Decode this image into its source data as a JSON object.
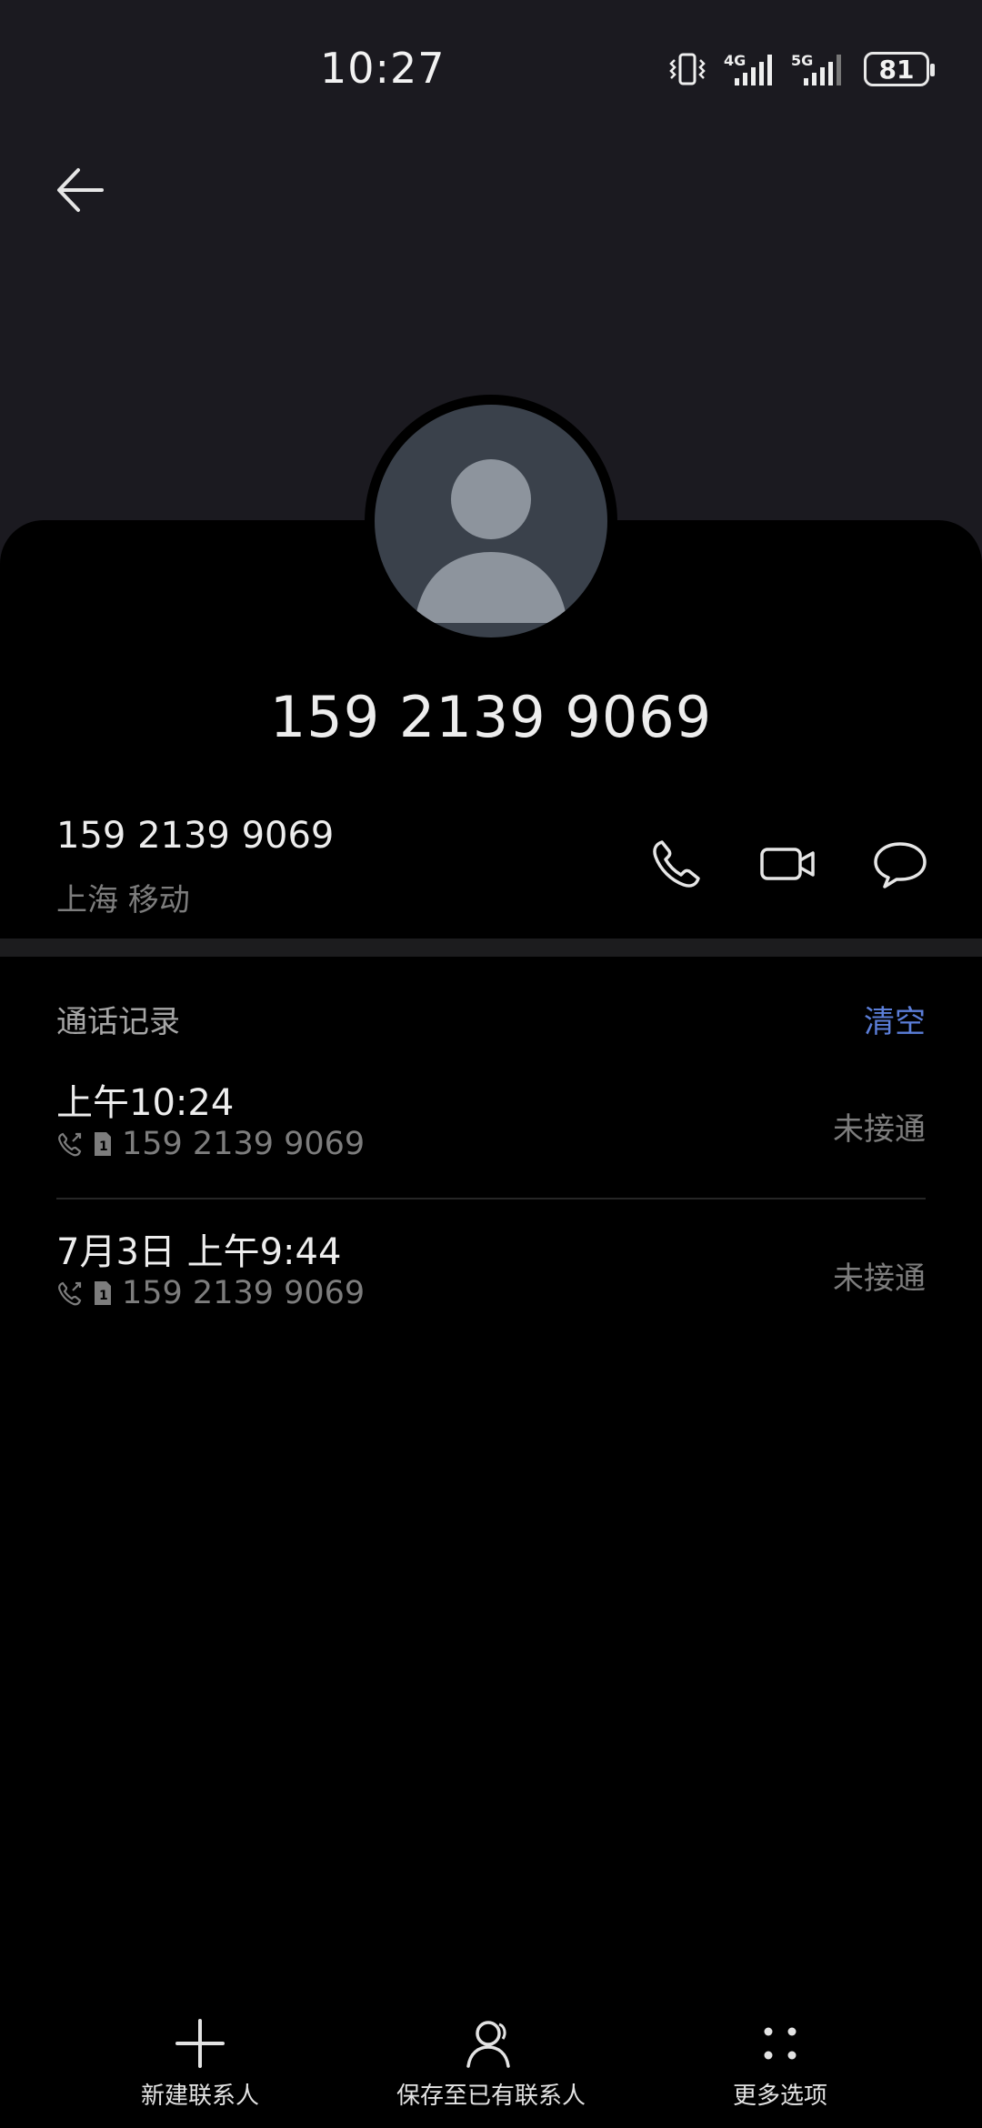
{
  "status_bar": {
    "time": "10:27",
    "network_1": "4G",
    "network_2": "5G",
    "battery": "81"
  },
  "header": {
    "title_number": "159 2139 9069"
  },
  "contact": {
    "number": "159 2139 9069",
    "location": "上海 移动"
  },
  "call_log": {
    "title": "通话记录",
    "clear_label": "清空",
    "items": [
      {
        "time": "上午10:24",
        "number": "159 2139 9069",
        "status": "未接通"
      },
      {
        "time": "7月3日 上午9:44",
        "number": "159 2139 9069",
        "status": "未接通"
      }
    ]
  },
  "bottom_bar": {
    "new_contact": "新建联系人",
    "save_existing": "保存至已有联系人",
    "more_options": "更多选项"
  },
  "colors": {
    "header_bg": "#1b1a20",
    "accent": "#5b7ed8",
    "secondary_text": "#7d7d7d"
  }
}
